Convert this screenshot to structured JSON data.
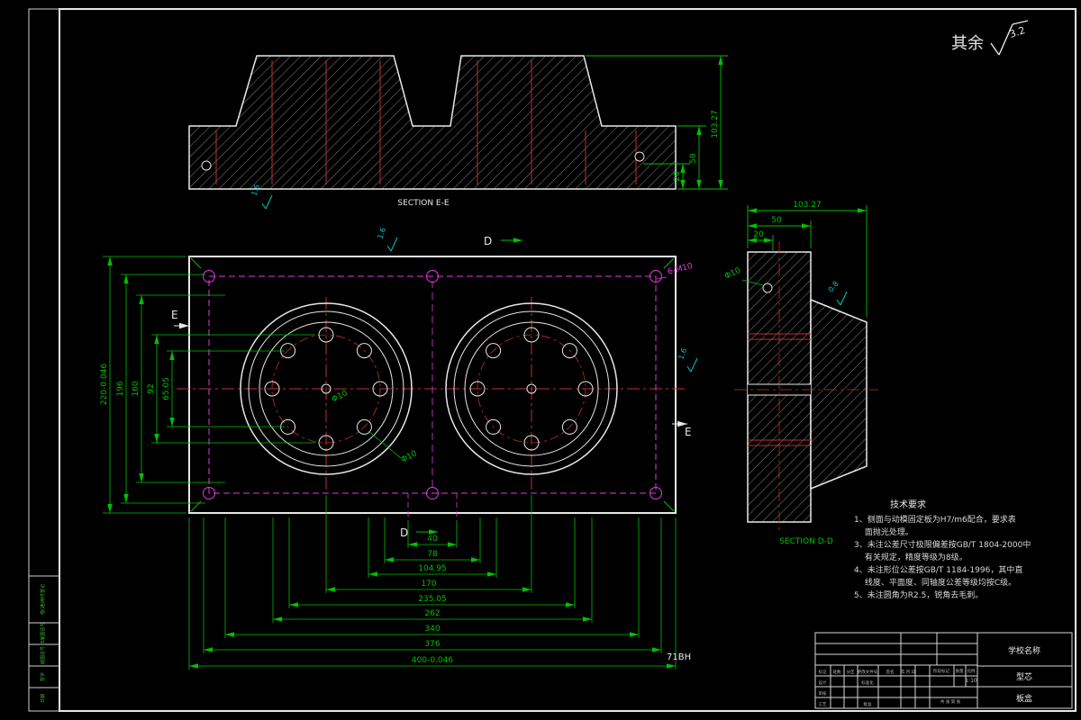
{
  "colors": {
    "background": "#000000",
    "outline": "#e8e8e8",
    "dimension": "#00c000",
    "phantom": "#e23ae2",
    "centerline": "#c03030",
    "finish": "#00c8c8"
  },
  "general_roughness": {
    "prefix": "其余",
    "value": "3.2"
  },
  "section_ee": {
    "label": "SECTION E-E",
    "dim_20": "20",
    "dim_50": "50",
    "dim_103": "103.27",
    "roughness": "1.6"
  },
  "section_dd": {
    "label": "SECTION D-D",
    "dim_20": "20",
    "dim_50": "50",
    "dim_103": "103.27",
    "hole": "Φ10",
    "roughness": "0.8"
  },
  "plan": {
    "left_dims": [
      "220-0.046",
      "196",
      "160",
      "92",
      "65.05"
    ],
    "bottom_dims": [
      "40",
      "78",
      "104.95",
      "170",
      "235.05",
      "262",
      "340",
      "376",
      "400-0.046"
    ],
    "thread_label": "6-M10",
    "hole_label_center": "Φ10",
    "hole_label_bolt": "Φ10",
    "roughness_top": "1.6",
    "roughness_right": "1.6",
    "cut_d": "D",
    "cut_e": "E"
  },
  "notes": {
    "title": "技术要求",
    "lines": [
      "1、侧面与动模固定板为H7/m6配合，要求表",
      "　 面抛光处理。",
      "3、未注公差尺寸极限偏差按GB/T 1804-2000中",
      "　 有关规定，精度等级为8级。",
      "4、未注形位公差按GB/T 1184-1996，其中直",
      "　 线度、平面度、同轴度公差等级均按C级。",
      "5、未注圆角为R2.5，锐角去毛刺。"
    ]
  },
  "part_code": "71BH",
  "title_block": {
    "school": "学校名称",
    "part": "型芯",
    "component": "板盒",
    "scale": "1:10",
    "col_mark": "标记",
    "col_count": "处数",
    "col_zone": "分区",
    "col_doc": "更改文件号",
    "col_sign": "签名",
    "col_date": "年.月.日",
    "row_design": "设计",
    "row_standard": "标准化",
    "row_check": "审核",
    "row_process": "工艺",
    "row_approve": "批准",
    "stage": "阶段标记",
    "weight": "质量",
    "scale_label": "比例",
    "sheets": "共 张 第 张"
  },
  "edge_strip": [
    "借(通)用件登记",
    "旧底图总号",
    "底图总号",
    "签字",
    "日期"
  ]
}
